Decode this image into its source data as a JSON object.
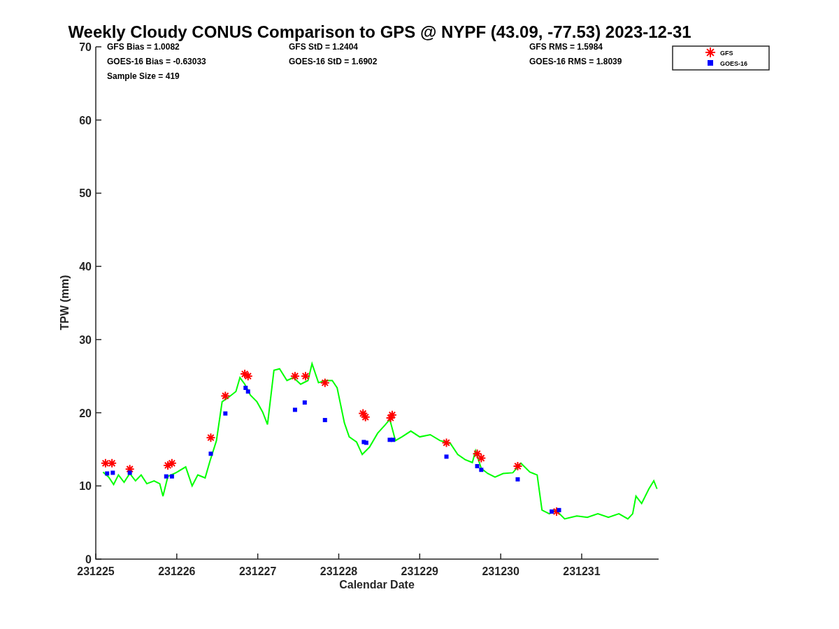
{
  "figure": {
    "statistics": [
      [
        "GFS Bias = 1.0082",
        "GOES-16 Bias = -0.63033",
        "Sample Size = 419"
      ],
      [
        "GFS StD = 1.2404",
        "GOES-16 StD = 1.6902"
      ],
      [
        "GFS RMS = 1.5984",
        "GOES-16 RMS = 1.8039"
      ]
    ],
    "chart_data": {
      "type": "scatter",
      "legend": "upper right",
      "title": "Weekly Cloudy CONUS Comparison to GPS @ NYPF (43.09, -77.53) 2023-12-31",
      "xlabel": "Calendar Date",
      "ylabel": "TPW (mm)",
      "xlim": [
        231225,
        231231.95
      ],
      "ylim": [
        0,
        70
      ],
      "xticks": [
        231225,
        231226,
        231227,
        231228,
        231229,
        231230,
        231231
      ],
      "yticks": [
        0,
        10,
        20,
        30,
        40,
        50,
        60,
        70
      ],
      "series": [
        {
          "type": "line",
          "color": "#00ff00",
          "marker": "none",
          "x": [
            231225.09,
            231225.16,
            231225.22,
            231225.28,
            231225.35,
            231225.42,
            231225.49,
            231225.56,
            231225.63,
            231225.72,
            231225.79,
            231225.83,
            231225.89,
            231225.99,
            231226.11,
            231226.19,
            231226.26,
            231226.35,
            231226.41,
            231226.49,
            231226.56,
            231226.65,
            231226.73,
            231226.78,
            231226.84,
            231226.91,
            231226.99,
            231227.06,
            231227.12,
            231227.2,
            231227.27,
            231227.36,
            231227.44,
            231227.53,
            231227.62,
            231227.67,
            231227.75,
            231227.83,
            231227.92,
            231227.98,
            231228.07,
            231228.13,
            231228.22,
            231228.29,
            231228.38,
            231228.48,
            231228.57,
            231228.63,
            231228.7,
            231228.78,
            231228.89,
            231229.0,
            231229.13,
            231229.25,
            231229.38,
            231229.47,
            231229.56,
            231229.65,
            231229.69,
            231229.76,
            231229.84,
            231229.93,
            231230.03,
            231230.15,
            231230.25,
            231230.36,
            231230.45,
            231230.51,
            231230.6,
            231230.68,
            231230.79,
            231230.94,
            231231.07,
            231231.2,
            231231.33,
            231231.46,
            231231.57,
            231231.63,
            231231.67,
            231231.74,
            231231.83,
            231231.89,
            231231.93
          ],
          "values": [
            11.9,
            11.2,
            10.2,
            11.5,
            10.5,
            11.7,
            10.7,
            11.5,
            10.3,
            10.7,
            10.3,
            8.6,
            11.3,
            11.8,
            12.6,
            10.0,
            11.5,
            11.1,
            13.4,
            16.2,
            21.5,
            22.2,
            22.9,
            24.8,
            23.9,
            22.4,
            21.5,
            20.1,
            18.4,
            25.8,
            26.0,
            24.4,
            24.8,
            23.9,
            24.4,
            26.7,
            24.1,
            24.4,
            24.4,
            23.4,
            18.6,
            16.7,
            16.0,
            14.3,
            15.3,
            17.2,
            18.3,
            19.1,
            16.2,
            16.7,
            17.5,
            16.7,
            17.0,
            16.2,
            15.8,
            14.3,
            13.6,
            13.2,
            14.8,
            12.4,
            11.7,
            11.2,
            11.7,
            11.8,
            13.1,
            11.9,
            11.5,
            6.7,
            6.2,
            6.7,
            5.5,
            5.9,
            5.7,
            6.2,
            5.7,
            6.2,
            5.5,
            6.2,
            8.6,
            7.6,
            9.6,
            10.7,
            9.6
          ]
        },
        {
          "name": "GFS",
          "color": "#ff0000",
          "marker": "cross",
          "x": [
            231225.12,
            231225.2,
            231225.42,
            231225.89,
            231225.94,
            231226.42,
            231226.6,
            231226.84,
            231226.88,
            231227.46,
            231227.59,
            231227.83,
            231228.3,
            231228.33,
            231228.64,
            231228.66,
            231229.33,
            231229.71,
            231229.76,
            231230.21,
            231230.69
          ],
          "values": [
            13.1,
            13.1,
            12.3,
            12.8,
            13.1,
            16.6,
            22.3,
            25.3,
            25.0,
            25.0,
            25.0,
            24.1,
            19.9,
            19.4,
            19.3,
            19.7,
            15.9,
            14.4,
            13.8,
            12.7,
            6.5
          ]
        },
        {
          "name": "GOES-16",
          "color": "#0000ff",
          "marker": "square",
          "x": [
            231225.14,
            231225.21,
            231225.42,
            231225.87,
            231225.94,
            231226.42,
            231226.6,
            231226.85,
            231226.88,
            231227.46,
            231227.58,
            231227.83,
            231228.31,
            231228.34,
            231228.63,
            231228.67,
            231229.33,
            231229.71,
            231229.76,
            231230.21,
            231230.63,
            231230.72
          ],
          "values": [
            11.7,
            11.8,
            11.8,
            11.3,
            11.3,
            14.4,
            19.9,
            23.4,
            22.9,
            20.4,
            21.4,
            19.0,
            16.0,
            15.9,
            16.3,
            16.3,
            14.0,
            12.7,
            12.2,
            10.9,
            6.5,
            6.7
          ]
        }
      ]
    }
  }
}
